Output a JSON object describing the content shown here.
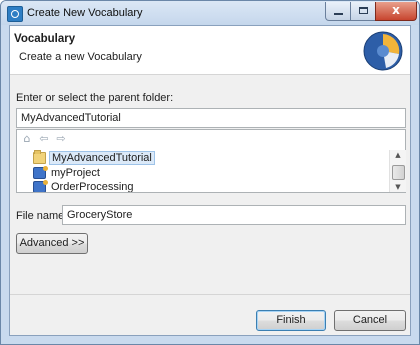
{
  "window": {
    "title": "Create New Vocabulary"
  },
  "header": {
    "title": "Vocabulary",
    "subtitle": "Create a new Vocabulary"
  },
  "parent_folder": {
    "label": "Enter or select the parent folder:",
    "value": "MyAdvancedTutorial"
  },
  "tree": {
    "items": [
      {
        "label": "MyAdvancedTutorial",
        "icon": "folder-icon",
        "selected": true
      },
      {
        "label": "myProject",
        "icon": "project-icon",
        "selected": false
      },
      {
        "label": "OrderProcessing",
        "icon": "project-icon",
        "selected": false
      }
    ]
  },
  "file_name": {
    "label": "File name:",
    "value": "GroceryStore"
  },
  "buttons": {
    "advanced": "Advanced >>",
    "finish": "Finish",
    "cancel": "Cancel"
  },
  "caption": {
    "close_glyph": "x"
  }
}
